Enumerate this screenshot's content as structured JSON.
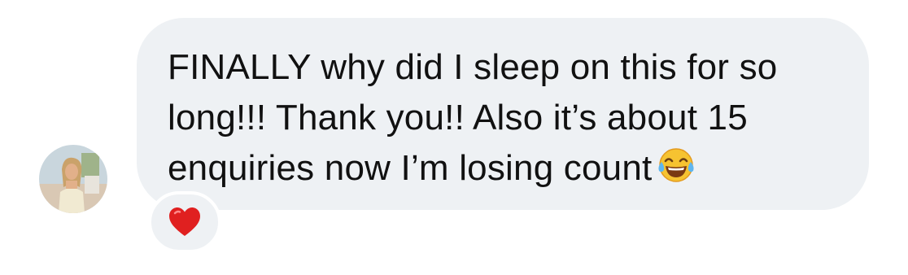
{
  "message": {
    "text": "FINALLY why did I sleep on this for so long!!! Thank you!! Also it’s about 15 enquiries now I’m losing count",
    "emoji": "face-with-tears-of-joy"
  },
  "sender": {
    "avatar_icon": "profile-photo"
  },
  "reaction": {
    "emoji": "red-heart",
    "color": "#e02020"
  },
  "colors": {
    "bubble_background": "#eef1f4",
    "text": "#111111",
    "page_background": "#ffffff"
  }
}
